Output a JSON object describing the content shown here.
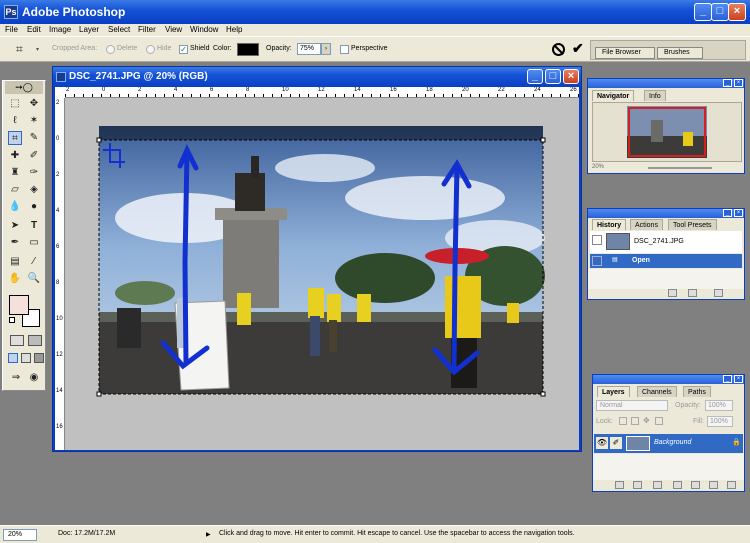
{
  "app": {
    "title": "Adobe Photoshop",
    "logo_text": "Ps"
  },
  "menu": [
    "File",
    "Edit",
    "Image",
    "Layer",
    "Select",
    "Filter",
    "View",
    "Window",
    "Help"
  ],
  "options": {
    "cropped_area_label": "Cropped Area:",
    "delete_label": "Delete",
    "hide_label": "Hide",
    "shield_label": "Shield",
    "color_label": "Color:",
    "opacity_label": "Opacity:",
    "opacity_value": "75%",
    "perspective_label": "Perspective",
    "shield_color": "#000000",
    "cancel_icon": "cancel-crop-icon",
    "commit_icon": "commit-crop-icon"
  },
  "palette_well": {
    "tabs": [
      "File Browser",
      "Brushes"
    ]
  },
  "document": {
    "title": "DSC_2741.JPG @ 20% (RGB)",
    "ruler_top": [
      "2",
      "0",
      "2",
      "4",
      "6",
      "8",
      "10",
      "12",
      "14",
      "16",
      "18",
      "20",
      "22",
      "24",
      "26"
    ],
    "ruler_left": [
      "2",
      "0",
      "2",
      "4",
      "6",
      "8",
      "10",
      "12",
      "14",
      "16"
    ]
  },
  "navigator": {
    "tabs": [
      "Navigator",
      "Info"
    ],
    "zoom": "20%"
  },
  "history": {
    "tabs": [
      "History",
      "Actions",
      "Tool Presets"
    ],
    "snapshot": "DSC_2741.JPG",
    "items": [
      "Open"
    ]
  },
  "layers": {
    "tabs": [
      "Layers",
      "Channels",
      "Paths"
    ],
    "blend_mode": "Normal",
    "opacity_label": "Opacity:",
    "opacity_value": "100%",
    "lock_label": "Lock:",
    "fill_label": "Fill:",
    "fill_value": "100%",
    "layer_name": "Background"
  },
  "status": {
    "zoom": "20%",
    "doc": "Doc: 17.2M/17.2M",
    "hint": "Click and drag to move. Hit enter to commit. Hit escape to cancel. Use the spacebar to access the navigation tools."
  },
  "colors": {
    "xp_blue": "#0a3fc4",
    "selected": "#316ac5",
    "foreground": "#f5e0dc",
    "background": "#ffffff"
  }
}
